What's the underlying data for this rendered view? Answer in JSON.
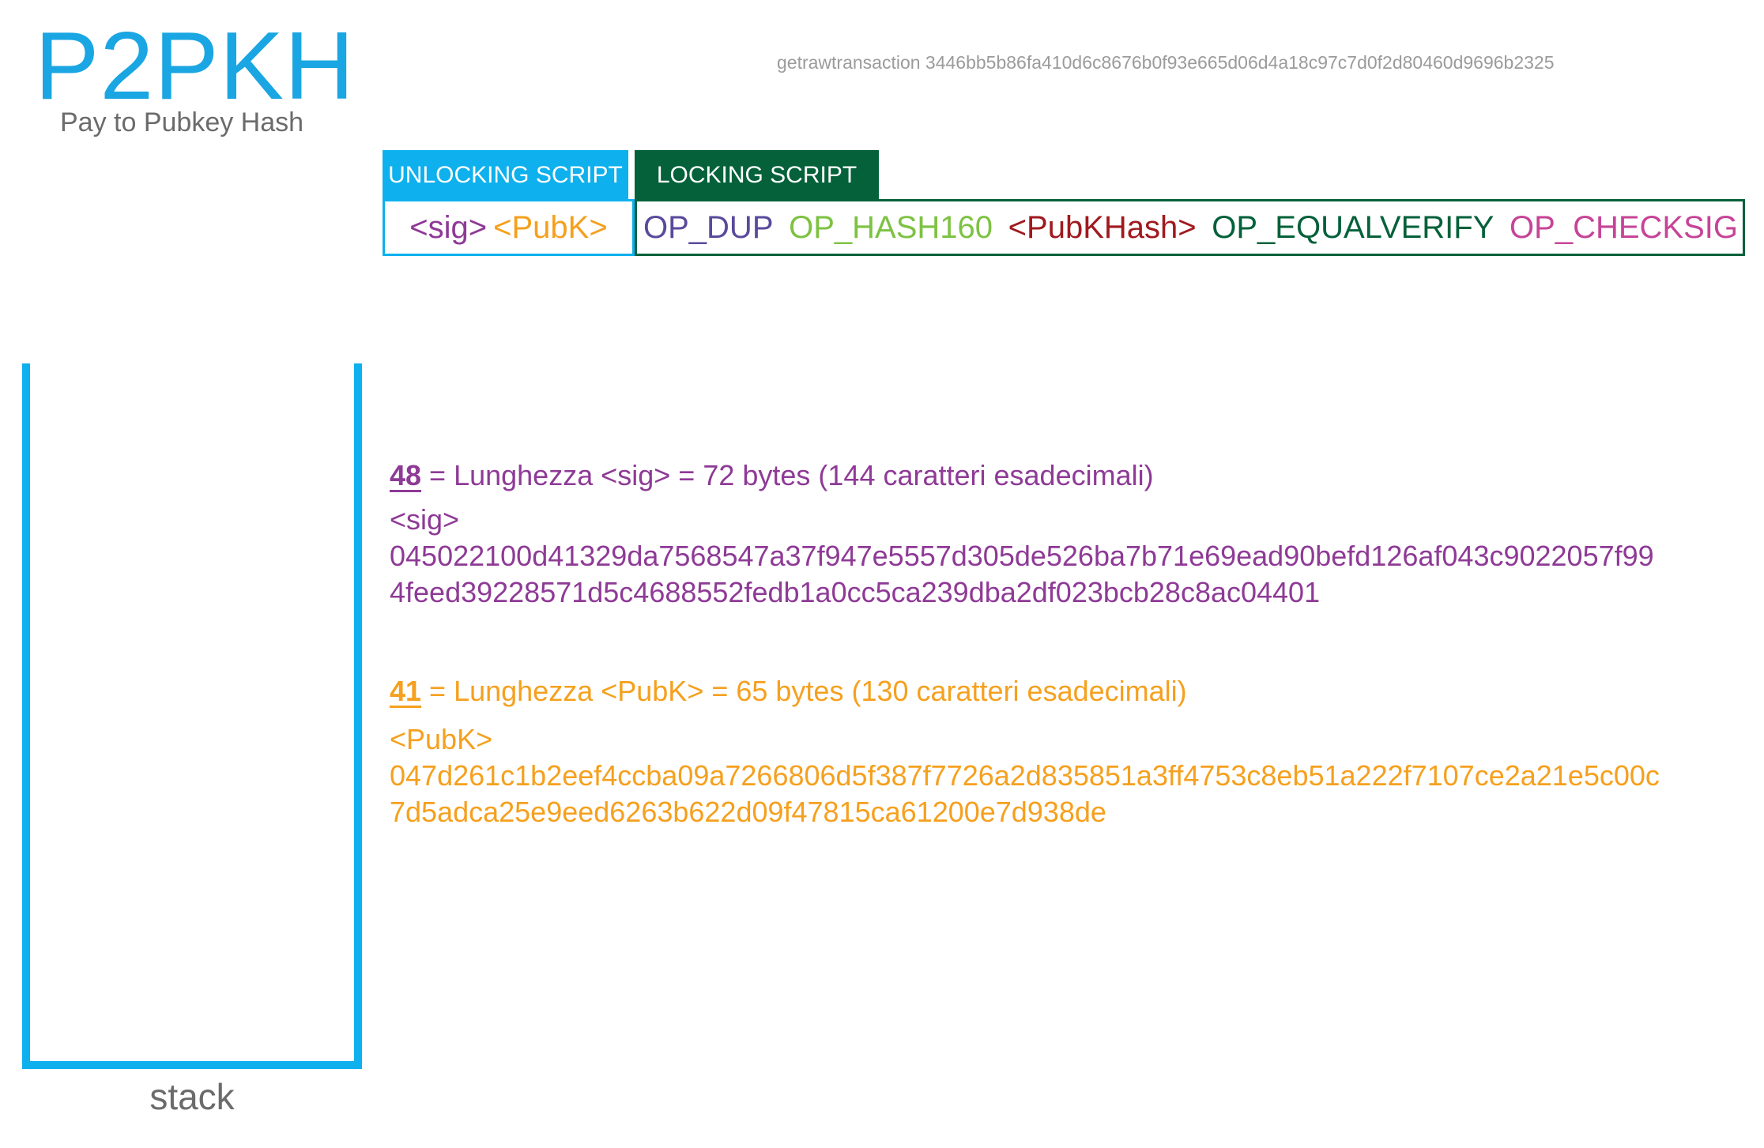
{
  "title": "P2PKH",
  "subtitle": "Pay to Pubkey Hash",
  "command": "getrawtransaction 3446bb5b86fa410d6c8676b0f93e665d06d4a18c97c7d0f2d80460d9696b2325",
  "unlocking": {
    "label": "UNLOCKING SCRIPT",
    "tokens": [
      {
        "text": "<sig>",
        "color": "#8e3a96"
      },
      {
        "text": "<PubK>",
        "color": "#f5a01e"
      }
    ]
  },
  "locking": {
    "label": "LOCKING SCRIPT",
    "tokens": [
      {
        "text": "OP_DUP",
        "color": "#5a4a9c"
      },
      {
        "text": "OP_HASH160",
        "color": "#7dc242"
      },
      {
        "text": "<PubKHash>",
        "color": "#a0191e"
      },
      {
        "text": "OP_EQUALVERIFY",
        "color": "#04613a"
      },
      {
        "text": "OP_CHECKSIG",
        "color": "#c64497"
      }
    ]
  },
  "stack": {
    "label": "stack"
  },
  "sig_section": {
    "length_hex": "48",
    "length_text": " = Lunghezza <sig> = 72 bytes (144 caratteri esadecimali)",
    "label": "<sig>",
    "hex_line1": "045022100d41329da7568547a37f947e5557d305de526ba7b71e69ead90befd126af043c9022057f99",
    "hex_line2": "4feed39228571d5c4688552fedb1a0cc5ca239dba2df023bcb28c8ac04401",
    "color": "#8e3a96"
  },
  "pubk_section": {
    "length_hex": "41",
    "length_text": " = Lunghezza <PubK> = 65 bytes (130 caratteri esadecimali)",
    "label": "<PubK>",
    "hex_line1": "047d261c1b2eef4ccba09a7266806d5f387f7726a2d835851a3ff4753c8eb51a222f7107ce2a21e5c00c",
    "hex_line2": "7d5adca25e9eed6263b622d09f47815ca61200e7d938de",
    "color": "#f5a01e"
  }
}
